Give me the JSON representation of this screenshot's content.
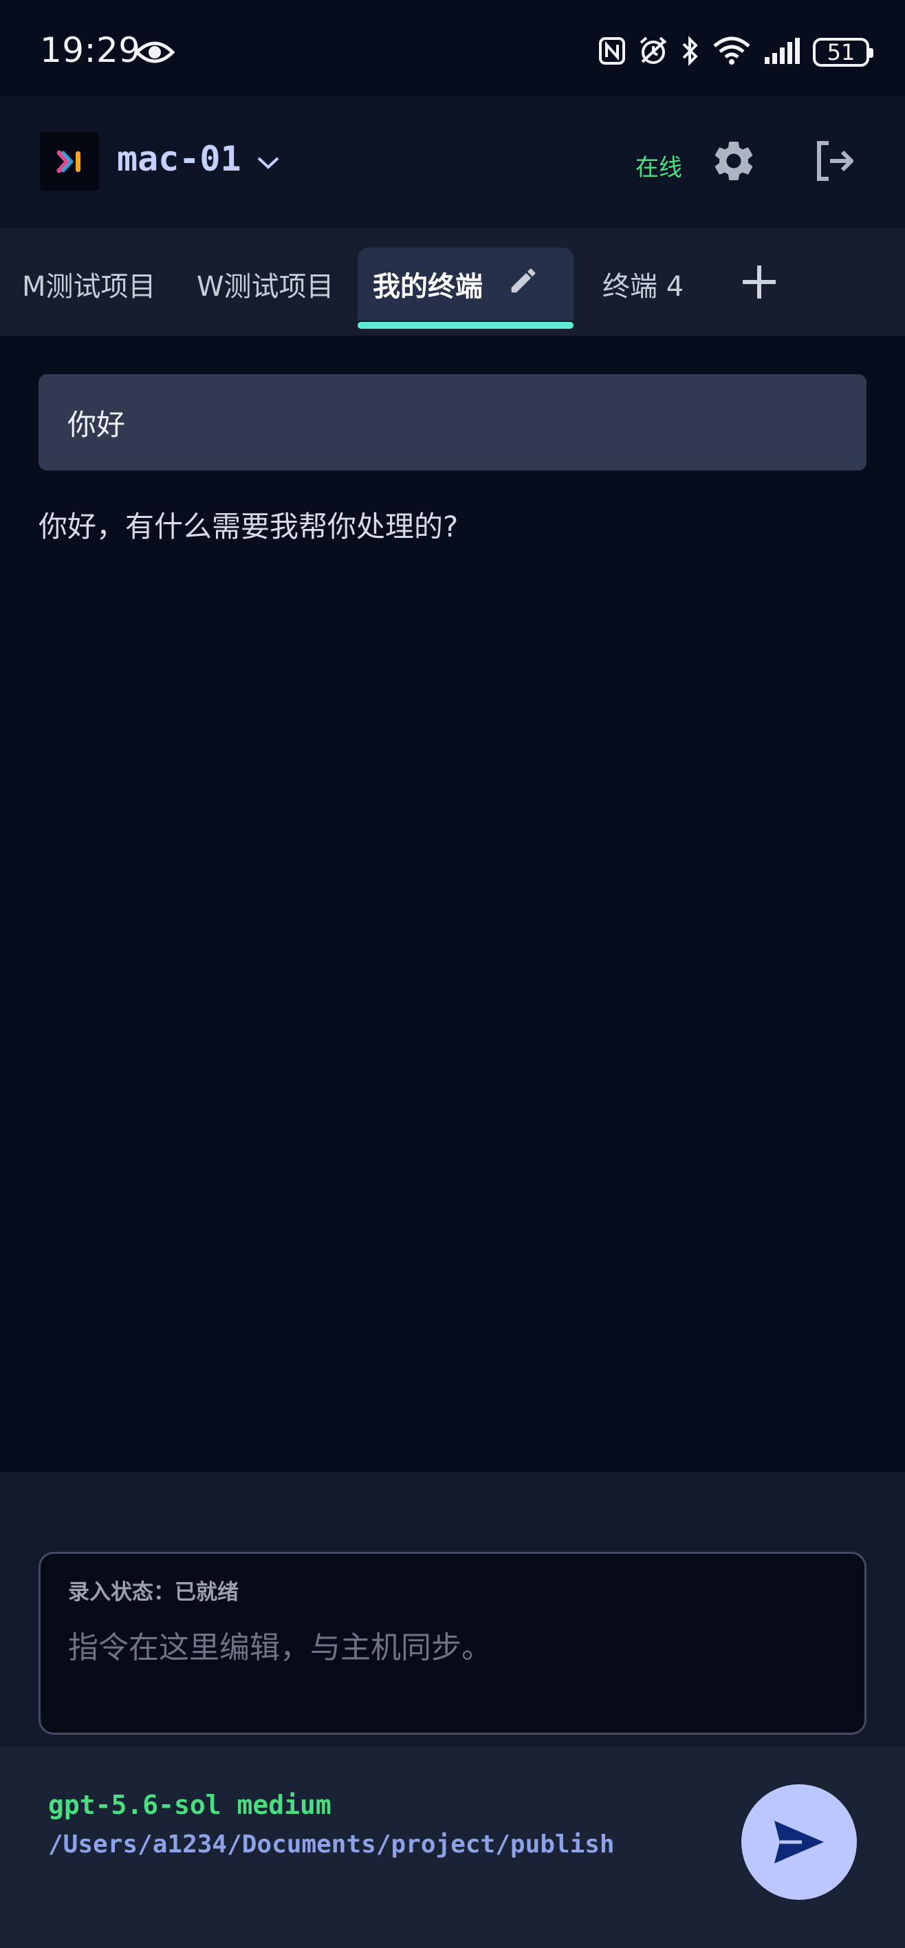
{
  "status_bar": {
    "time": "19:29",
    "battery": "51",
    "icons": [
      "eye-icon",
      "nfc-icon",
      "alarm-icon",
      "bluetooth-icon",
      "wifi-icon",
      "signal-icon",
      "battery-icon"
    ]
  },
  "header": {
    "host_name": "mac-01",
    "connection_status": "在线",
    "status_color": "#4ade80",
    "icons": [
      "app-logo-icon",
      "chevron-down-icon",
      "gear-icon",
      "logout-icon"
    ]
  },
  "tabs": [
    {
      "label": "M测试项目",
      "active": false
    },
    {
      "label": "W测试项目",
      "active": false
    },
    {
      "label": "我的终端",
      "active": true
    },
    {
      "label": "终端 4",
      "active": false
    }
  ],
  "chat": {
    "user_message": "你好",
    "assistant_reply": "你好，有什么需要我帮你处理的?"
  },
  "input": {
    "status_label": "录入状态：已就绪",
    "placeholder": "指令在这里编辑，与主机同步。",
    "value": ""
  },
  "footer": {
    "model": "gpt-5.6-sol medium",
    "path": "/Users/a1234/Documents/project/publish"
  },
  "colors": {
    "background": "#080d1d",
    "accent_tab_underline": "#5eead4",
    "send_button": "#bcc7ff"
  }
}
